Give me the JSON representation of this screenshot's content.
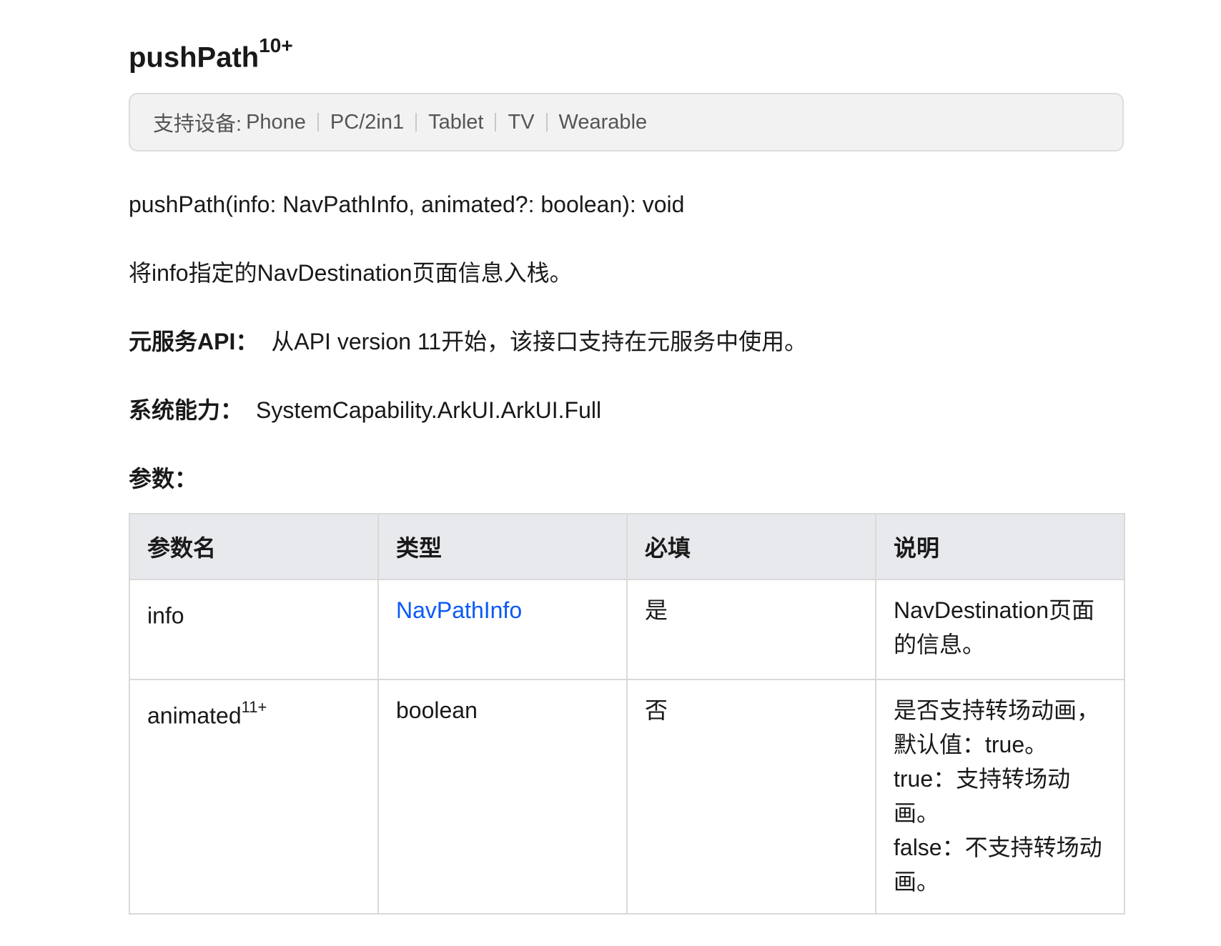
{
  "title": {
    "name": "pushPath",
    "version_sup": "10+"
  },
  "devices": {
    "label": "支持设备:",
    "items": [
      "Phone",
      "PC/2in1",
      "Tablet",
      "TV",
      "Wearable"
    ]
  },
  "signature": "pushPath(info: NavPathInfo, animated?: boolean): void",
  "description": "将info指定的NavDestination页面信息入栈。",
  "atomic_service": {
    "label": "元服务API：",
    "text": "从API version 11开始，该接口支持在元服务中使用。"
  },
  "system_capability": {
    "label": "系统能力：",
    "text": "SystemCapability.ArkUI.ArkUI.Full"
  },
  "params_heading": "参数：",
  "table": {
    "headers": [
      "参数名",
      "类型",
      "必填",
      "说明"
    ],
    "rows": [
      {
        "name": "info",
        "name_sup": "",
        "type": "NavPathInfo",
        "required": "是",
        "desc": [
          "NavDestination页面的信息。"
        ]
      },
      {
        "name": "animated",
        "name_sup": "11+",
        "type": "boolean",
        "required": "否",
        "desc": [
          "是否支持转场动画，默认值：true。",
          "true：支持转场动画。",
          "false：不支持转场动画。"
        ]
      }
    ]
  }
}
